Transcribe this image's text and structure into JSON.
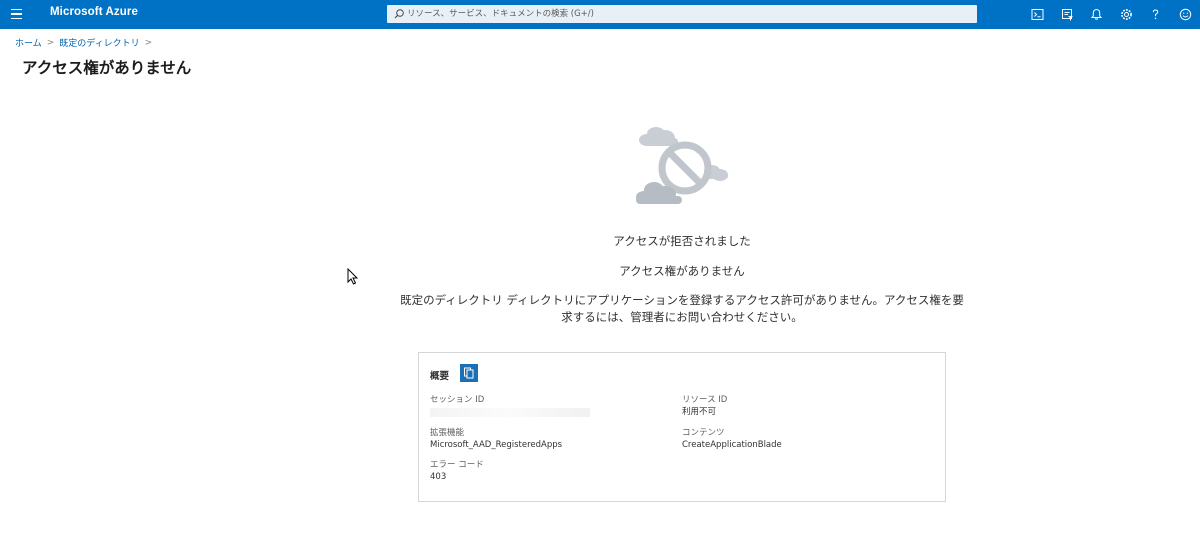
{
  "app": {
    "brand": "Microsoft Azure"
  },
  "search": {
    "placeholder": "リソース、サービス、ドキュメントの検索 (G+/)"
  },
  "top_icons": [
    "cloud-shell-icon",
    "directory-filter-icon",
    "notifications-icon",
    "settings-icon",
    "help-icon",
    "feedback-icon"
  ],
  "breadcrumb": {
    "home": "ホーム",
    "directory": "既定のディレクトリ"
  },
  "page": {
    "title": "アクセス権がありません"
  },
  "message": {
    "denied": "アクセスが拒否されました",
    "no_access": "アクセス権がありません",
    "detail_line1": "既定のディレクトリ ディレクトリにアプリケーションを登録するアクセス許可がありません。アクセス権を要",
    "detail_line2": "求するには、管理者にお問い合わせください。"
  },
  "summary": {
    "title": "概要",
    "session_id_label": "セッション ID",
    "session_id_value": "",
    "resource_id_label": "リソース ID",
    "resource_id_value": "利用不可",
    "extension_label": "拡張機能",
    "extension_value": "Microsoft_AAD_RegisteredApps",
    "content_label": "コンテンツ",
    "content_value": "CreateApplicationBlade",
    "error_code_label": "エラー コード",
    "error_code_value": "403"
  },
  "colors": {
    "topbar": "#0072c6",
    "link": "#0062ad",
    "copy_button": "#1a6fb5"
  }
}
